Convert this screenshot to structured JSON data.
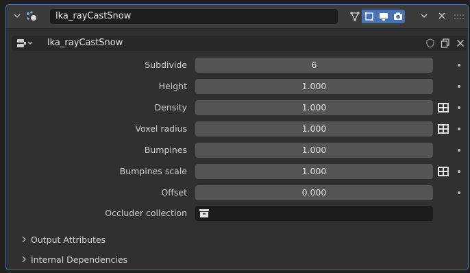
{
  "modifier": {
    "name": "lka_rayCastSnow",
    "toggles": [
      "edit-mode-icon",
      "on-cage-icon",
      "viewport-icon",
      "render-icon"
    ]
  },
  "node_group": {
    "name": "lka_rayCastSnow"
  },
  "properties": [
    {
      "label": "Subdivide",
      "value": "6",
      "attr": false
    },
    {
      "label": "Height",
      "value": "1.000",
      "attr": false
    },
    {
      "label": "Density",
      "value": "1.000",
      "attr": true
    },
    {
      "label": "Voxel radius",
      "value": "1.000",
      "attr": true
    },
    {
      "label": "Bumpines",
      "value": "1.000",
      "attr": false
    },
    {
      "label": "Bumpines scale",
      "value": "1.000",
      "attr": true
    },
    {
      "label": "Offset",
      "value": "0.000",
      "attr": false
    }
  ],
  "occluder": {
    "label": "Occluder collection",
    "value": ""
  },
  "sections": [
    {
      "label": "Output Attributes"
    },
    {
      "label": "Internal Dependencies"
    }
  ],
  "colors": {
    "panel_bg": "#303030",
    "field_bg": "#545454",
    "accent": "#4772b3",
    "border": "#4f6fa8"
  }
}
